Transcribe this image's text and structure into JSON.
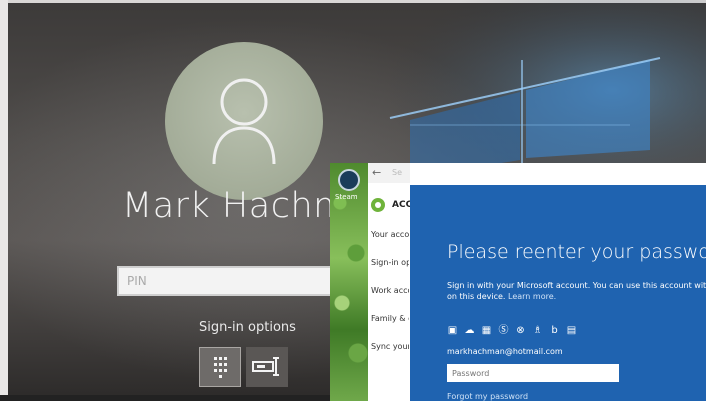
{
  "lock_screen": {
    "user_name": "Mark Hachm",
    "pin_placeholder": "PIN",
    "signin_options_label": "Sign-in options",
    "signin_option_icons": [
      "pin-keypad-icon",
      "password-key-icon"
    ]
  },
  "overlay": {
    "desktop": {
      "app_icon": "steam-icon",
      "app_label": "Steam"
    },
    "settings": {
      "back_icon": "back-arrow-icon",
      "title_stub": "Se",
      "section_icon": "gear-icon",
      "section_title": "ACC",
      "nav_items": [
        "Your acco",
        "Sign-in op",
        "Work acco",
        "Family & o",
        "Sync your"
      ]
    },
    "dialog": {
      "title": "Please reenter your password",
      "description_line1": "Sign in with your Microsoft account. You can use this account with o",
      "description_line2_prefix": "on this device.",
      "learn_more": "Learn more.",
      "service_icons": [
        "office-icon",
        "onedrive-icon",
        "windows-icon",
        "skype-icon",
        "xbox-icon",
        "msn-icon",
        "bing-icon",
        "store-icon"
      ],
      "email": "markhachman@hotmail.com",
      "password_placeholder": "Password",
      "forgot_password": "Forgot my password"
    }
  },
  "colors": {
    "dialog_blue": "#1f63b0",
    "avatar_green": "#a3ac98",
    "accent_green": "#6fb33b"
  }
}
